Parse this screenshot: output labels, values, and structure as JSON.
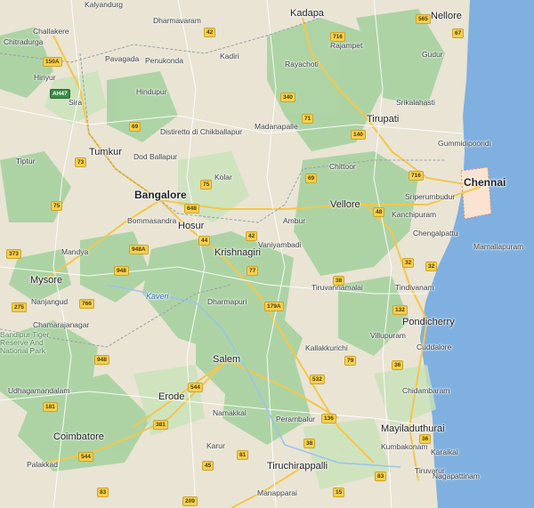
{
  "map": {
    "cities_major": [
      "Bangalore",
      "Chennai"
    ],
    "cities_mid": [
      "Mysore",
      "Hosur",
      "Krishnagiri",
      "Vellore",
      "Tirupati",
      "Salem",
      "Erode",
      "Coimbatore",
      "Pondicherry",
      "Tiruchirappalli",
      "Tumkur",
      "Mayiladuthurai",
      "Kadapa",
      "Nellore"
    ],
    "towns": [
      "Kalyandurg",
      "Dharmavaram",
      "Chitradurga",
      "Challakere",
      "Pavagada",
      "Penukonda",
      "Kadiri",
      "Rayachoti",
      "Rajampet",
      "Gudur",
      "Hiriyur",
      "Sira",
      "Hindupur",
      "Madanapalle",
      "Srikalahasti",
      "Tiptur",
      "Distiretto di Chikballapur",
      "Dod Ballapur",
      "Kolar",
      "Chittoor",
      "Gummidipoondi",
      "Sriperumbudur",
      "Kanchipuram",
      "Ambur",
      "Bommasandra",
      "Chengalpattu",
      "Mamallapuram",
      "Vaniyambadi",
      "Mandya",
      "Nanjangud",
      "Dharmapuri",
      "Tiruvannamalai",
      "Tindivanam",
      "Chamarajanagar",
      "Villupuram",
      "Cuddalore",
      "Kallakkurichi",
      "Udhagamandalam",
      "Namakkal",
      "Chidambaram",
      "Perambalur",
      "Palakkad",
      "Karur",
      "Kumbakonam",
      "Karaikal",
      "Tiruvarur",
      "Nagapattinam",
      "Manapparai",
      "Bandipur Tiger Reserve And National Park"
    ],
    "rivers": [
      "Kaveri"
    ],
    "highways": [
      "42",
      "716",
      "565",
      "67",
      "150A",
      "AH47",
      "69",
      "340",
      "71",
      "140",
      "716",
      "73",
      "48",
      "75",
      "648",
      "44",
      "69",
      "75",
      "42",
      "948A",
      "948",
      "77",
      "179A",
      "38",
      "32",
      "132",
      "766",
      "275",
      "948",
      "544",
      "79",
      "532",
      "36",
      "181",
      "544",
      "381",
      "136",
      "81",
      "83",
      "45",
      "36",
      "32",
      "373",
      "209",
      "83",
      "38",
      "15"
    ]
  }
}
